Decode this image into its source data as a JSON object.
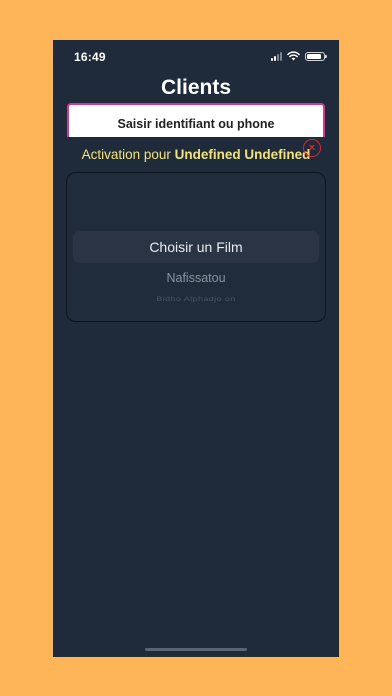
{
  "status_bar": {
    "time": "16:49",
    "battery_level": 0.9
  },
  "header": {
    "title": "Clients"
  },
  "search": {
    "placeholder": "Saisir identifiant ou phone",
    "value": ""
  },
  "activation": {
    "prefix": "Activation pour ",
    "name": "Undefined Undefined"
  },
  "close_button": {
    "icon": "close-icon",
    "glyph": "×"
  },
  "picker": {
    "selected": "Choisir un Film",
    "options": [
      "Nafissatou",
      "Bidho Alphadjo on"
    ]
  },
  "colors": {
    "background": "#FDB557",
    "screen": "#1F2A3A",
    "activation_text": "#F2E47A",
    "search_border": "#D63A8E",
    "close": "#E0262F"
  }
}
